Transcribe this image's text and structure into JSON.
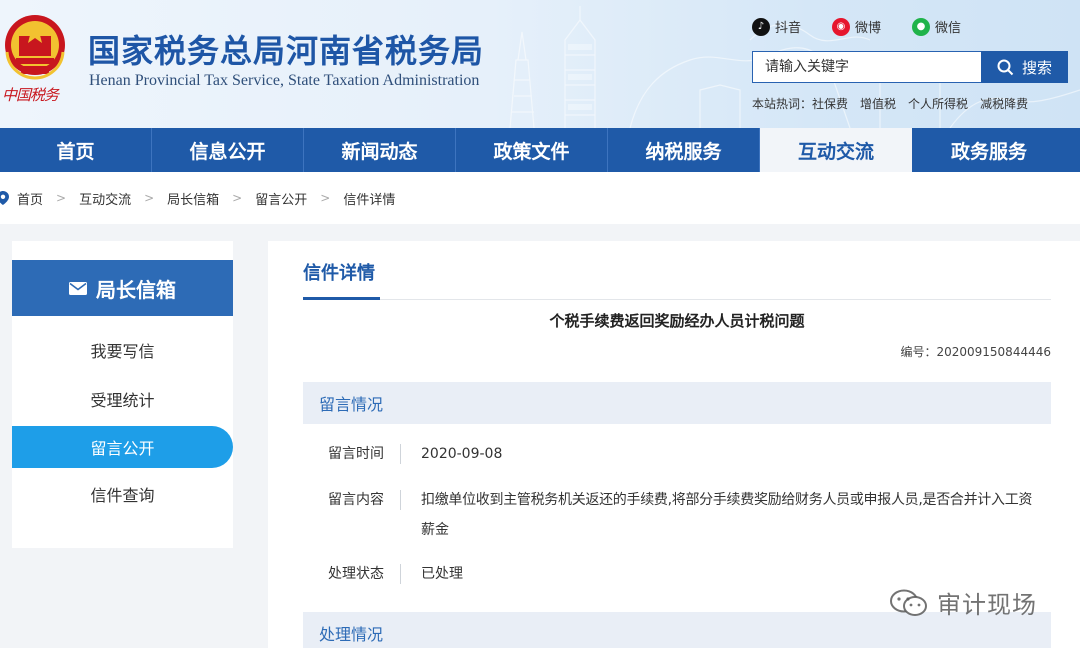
{
  "header": {
    "site_title": "国家税务总局河南省税务局",
    "site_subtitle": "Henan Provincial Tax Service, State Taxation Administration",
    "logo_caption": "中国税务",
    "social": {
      "douyin": "抖音",
      "weibo": "微博",
      "wechat": "微信"
    },
    "search": {
      "placeholder": "请输入关键字",
      "button_label": "搜索"
    },
    "hotwords": {
      "label": "本站热词：",
      "items": [
        "社保费",
        "增值税",
        "个人所得税",
        "减税降费"
      ]
    }
  },
  "nav": {
    "items": [
      "首页",
      "信息公开",
      "新闻动态",
      "政策文件",
      "纳税服务",
      "互动交流",
      "政务服务"
    ],
    "active_index": 5
  },
  "breadcrumb": [
    "首页",
    "互动交流",
    "局长信箱",
    "留言公开",
    "信件详情"
  ],
  "sidebar": {
    "title": "局长信箱",
    "items": [
      "我要写信",
      "受理统计",
      "留言公开",
      "信件查询"
    ],
    "active_index": 2
  },
  "main": {
    "title": "信件详情",
    "letter_title": "个税手续费返回奖励经办人员计税问题",
    "letter_no_label": "编号：",
    "letter_no": "202009150844446",
    "message_section": "留言情况",
    "fields": [
      {
        "label": "留言时间",
        "value": "2020-09-08"
      },
      {
        "label": "留言内容",
        "value_line1": "扣缴单位收到主管税务机关返还的手续费,将部分手续费奖励给财务人员或申报人员,是否合并计入工资",
        "value_line2": "薪金"
      },
      {
        "label": "处理状态",
        "value": "已处理"
      }
    ],
    "handling_section": "处理情况"
  },
  "watermark": "审计现场",
  "colors": {
    "brand_blue": "#1f5aa8",
    "active_pill": "#1e9ee8",
    "section_bg": "#e9eef6",
    "emblem_red": "#c8161e"
  }
}
